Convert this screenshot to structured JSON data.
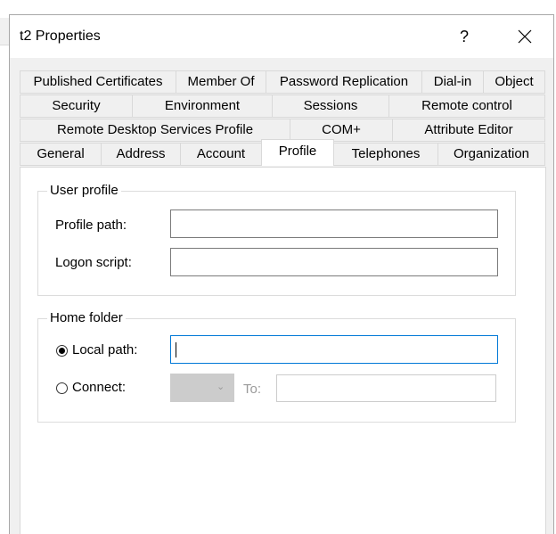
{
  "window": {
    "title": "t2 Properties",
    "help": "?"
  },
  "tabs": {
    "row1": [
      "Published Certificates",
      "Member Of",
      "Password Replication",
      "Dial-in",
      "Object"
    ],
    "row2": [
      "Security",
      "Environment",
      "Sessions",
      "Remote control"
    ],
    "row3": [
      "Remote Desktop Services Profile",
      "COM+",
      "Attribute Editor"
    ],
    "row4": [
      "General",
      "Address",
      "Account",
      "Profile",
      "Telephones",
      "Organization"
    ],
    "active": "Profile"
  },
  "user_profile": {
    "title": "User profile",
    "profile_path_label": "Profile path:",
    "profile_path_value": "",
    "logon_script_label": "Logon script:",
    "logon_script_value": ""
  },
  "home_folder": {
    "title": "Home folder",
    "local_path_label": "Local path:",
    "local_path_value": "",
    "local_path_selected": true,
    "connect_label": "Connect:",
    "to_label": "To:",
    "connect_value": ""
  }
}
